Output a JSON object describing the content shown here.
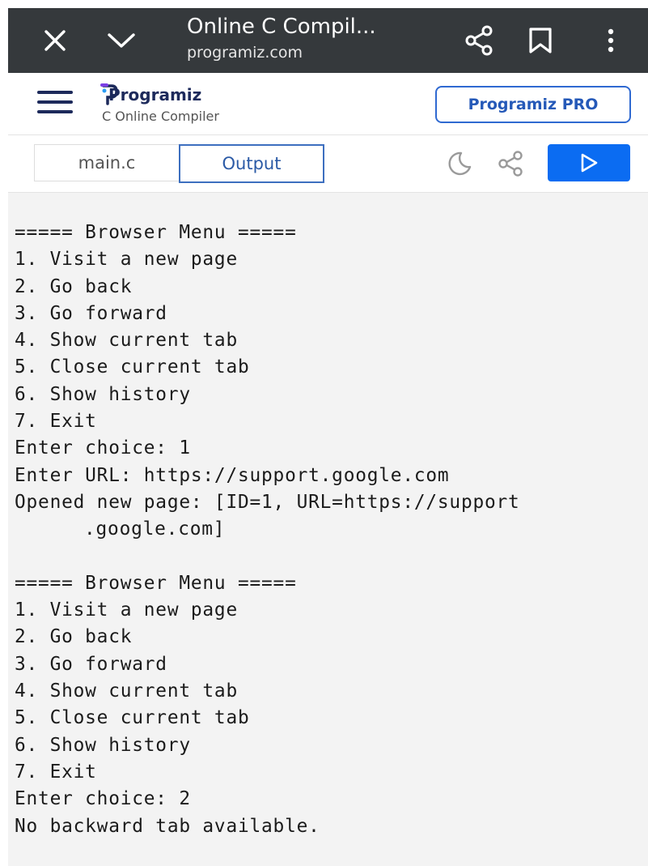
{
  "browser": {
    "title": "Online C Compil...",
    "url": "programiz.com"
  },
  "site": {
    "logo_text": "Programiz",
    "subtitle": "C Online Compiler",
    "pro_button": "Programiz PRO"
  },
  "toolbar": {
    "tabs": [
      {
        "label": "main.c",
        "active": false
      },
      {
        "label": "Output",
        "active": true
      }
    ]
  },
  "colors": {
    "topbar": "#35393c",
    "accent": "#0b6cf2",
    "brand": "#1d2a5b"
  },
  "output": {
    "lines": [
      "===== Browser Menu =====",
      "1. Visit a new page",
      "2. Go back",
      "3. Go forward",
      "4. Show current tab",
      "5. Close current tab",
      "6. Show history",
      "7. Exit",
      "Enter choice: 1",
      "Enter URL: https://support.google.com",
      "Opened new page: [ID=1, URL=https://support",
      ".google.com]",
      "",
      "===== Browser Menu =====",
      "1. Visit a new page",
      "2. Go back",
      "3. Go forward",
      "4. Show current tab",
      "5. Close current tab",
      "6. Show history",
      "7. Exit",
      "Enter choice: 2",
      "No backward tab available."
    ]
  }
}
